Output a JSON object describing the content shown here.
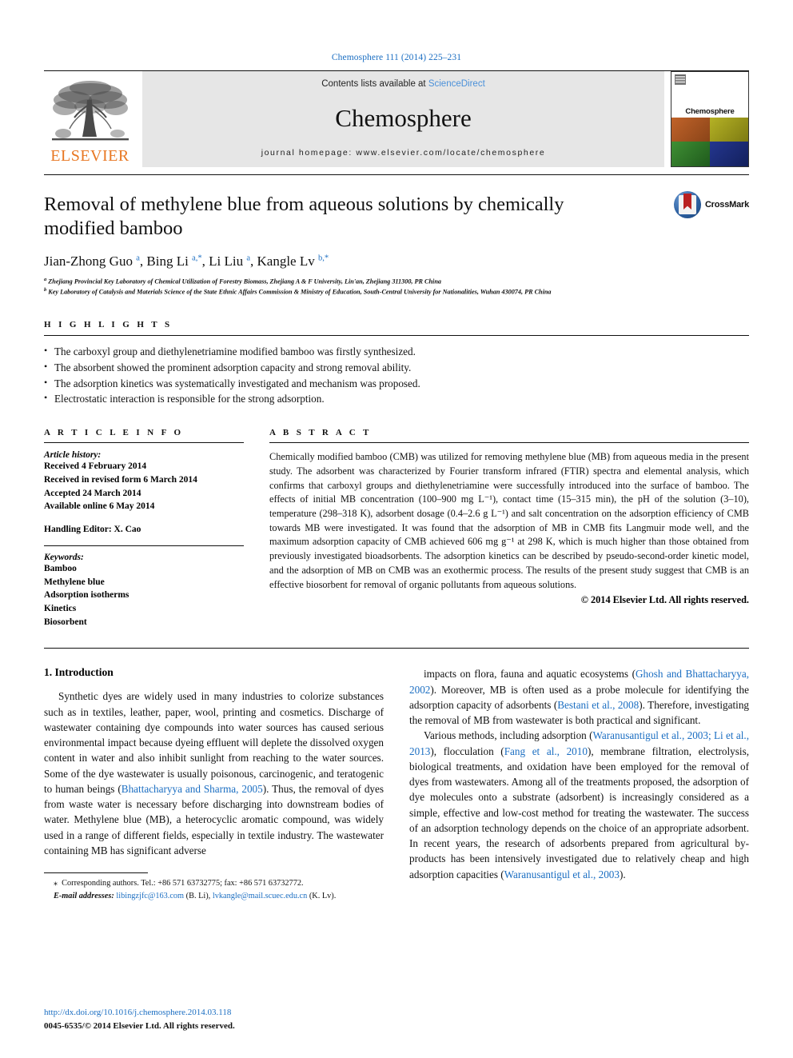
{
  "journal_ref": "Chemosphere 111 (2014) 225–231",
  "masthead": {
    "contents_prefix": "Contents lists available at ",
    "sciencedirect": "ScienceDirect",
    "journal_title": "Chemosphere",
    "homepage": "journal homepage: www.elsevier.com/locate/chemosphere",
    "publisher": "ELSEVIER",
    "cover_label": "Chemosphere"
  },
  "article": {
    "title": "Removal of methylene blue from aqueous solutions by chemically modified bamboo",
    "crossmark_label": "CrossMark",
    "authors_html": "Jian-Zhong Guo <sup>a</sup>, Bing Li <sup>a,</sup><sup>*</sup>, Li Liu <sup>a</sup>, Kangle Lv <sup>b,</sup><sup>*</sup>",
    "affiliations": [
      "Zhejiang Provincial Key Laboratory of Chemical Utilization of Forestry Biomass, Zhejiang A & F University, Lin'an, Zhejiang 311300, PR China",
      "Key Laboratory of Catalysis and Materials Science of the State Ethnic Affairs Commission & Ministry of Education, South-Central University for Nationalities, Wuhan 430074, PR China"
    ],
    "affiliation_marks": [
      "a",
      "b"
    ]
  },
  "highlights": {
    "heading": "H I G H L I G H T S",
    "items": [
      "The carboxyl group and diethylenetriamine modified bamboo was firstly synthesized.",
      "The absorbent showed the prominent adsorption capacity and strong removal ability.",
      "The adsorption kinetics was systematically investigated and mechanism was proposed.",
      "Electrostatic interaction is responsible for the strong adsorption."
    ]
  },
  "article_info": {
    "heading": "A R T I C L E    I N F O",
    "history_label": "Article history:",
    "history": [
      "Received 4 February 2014",
      "Received in revised form 6 March 2014",
      "Accepted 24 March 2014",
      "Available online 6 May 2014"
    ],
    "editor": "Handling Editor: X. Cao",
    "keywords_label": "Keywords:",
    "keywords": [
      "Bamboo",
      "Methylene blue",
      "Adsorption isotherms",
      "Kinetics",
      "Biosorbent"
    ]
  },
  "abstract": {
    "heading": "A B S T R A C T",
    "body": "Chemically modified bamboo (CMB) was utilized for removing methylene blue (MB) from aqueous media in the present study. The adsorbent was characterized by Fourier transform infrared (FTIR) spectra and elemental analysis, which confirms that carboxyl groups and diethylenetriamine were successfully introduced into the surface of bamboo. The effects of initial MB concentration (100–900 mg L⁻¹), contact time (15–315 min), the pH of the solution (3–10), temperature (298–318 K), adsorbent dosage (0.4–2.6 g L⁻¹) and salt concentration on the adsorption efficiency of CMB towards MB were investigated. It was found that the adsorption of MB in CMB fits Langmuir mode well, and the maximum adsorption capacity of CMB achieved 606 mg g⁻¹ at 298 K, which is much higher than those obtained from previously investigated bioadsorbents. The adsorption kinetics can be described by pseudo-second-order kinetic model, and the adsorption of MB on CMB was an exothermic process. The results of the present study suggest that CMB is an effective biosorbent for removal of organic pollutants from aqueous solutions.",
    "copyright": "© 2014 Elsevier Ltd. All rights reserved."
  },
  "introduction": {
    "heading": "1. Introduction",
    "left_paragraph_1_html": "Synthetic dyes are widely used in many industries to colorize substances such as in textiles, leather, paper, wool, printing and cosmetics. Discharge of wastewater containing dye compounds into water sources has caused serious environmental impact because dyeing effluent will deplete the dissolved oxygen content in water and also inhibit sunlight from reaching to the water sources. Some of the dye wastewater is usually poisonous, carcinogenic, and teratogenic to human beings (<a class=\"ref\" href=\"#\" data-name=\"citation-link\" data-interactable=\"true\">Bhattacharyya and Sharma, 2005</a>). Thus, the removal of dyes from waste water is necessary before discharging into downstream bodies of water. Methylene blue (MB), a heterocyclic aromatic compound, was widely used in a range of different fields, especially in textile industry. The wastewater containing MB has significant adverse",
    "right_paragraph_1_html": "impacts on flora, fauna and aquatic ecosystems (<a class=\"ref\" href=\"#\" data-name=\"citation-link\" data-interactable=\"true\">Ghosh and Bhattacharyya, 2002</a>). Moreover, MB is often used as a probe molecule for identifying the adsorption capacity of adsorbents (<a class=\"ref\" href=\"#\" data-name=\"citation-link\" data-interactable=\"true\">Bestani et al., 2008</a>). Therefore, investigating the removal of MB from wastewater is both practical and significant.",
    "right_paragraph_2_html": "Various methods, including adsorption (<a class=\"ref\" href=\"#\" data-name=\"citation-link\" data-interactable=\"true\">Waranusantigul et al., 2003; Li et al., 2013</a>), flocculation (<a class=\"ref\" href=\"#\" data-name=\"citation-link\" data-interactable=\"true\">Fang et al., 2010</a>), membrane filtration, electrolysis, biological treatments, and oxidation have been employed for the removal of dyes from wastewaters. Among all of the treatments proposed, the adsorption of dye molecules onto a substrate (adsorbent) is increasingly considered as a simple, effective and low-cost method for treating the wastewater. The success of an adsorption technology depends on the choice of an appropriate adsorbent. In recent years, the research of adsorbents prepared from agricultural by-products has been intensively investigated due to relatively cheap and high adsorption capacities (<a class=\"ref\" href=\"#\" data-name=\"citation-link\" data-interactable=\"true\">Waranusantigul et al., 2003</a>)."
  },
  "footnotes": {
    "corresponding_html": "<span class=\"star\">⁎</span>&nbsp; Corresponding authors. Tel.: +86 571 63732775; fax: +86 571 63732772.",
    "email_label": "E-mail addresses:",
    "email_1": "libingzjfc@163.com",
    "email_1_who": "(B. Li),",
    "email_2": "lvkangle@mail.scuec.edu.cn",
    "email_2_who": "(K. Lv)."
  },
  "footer": {
    "doi": "http://dx.doi.org/10.1016/j.chemosphere.2014.03.118",
    "issn": "0045-6535/© 2014 Elsevier Ltd. All rights reserved."
  }
}
